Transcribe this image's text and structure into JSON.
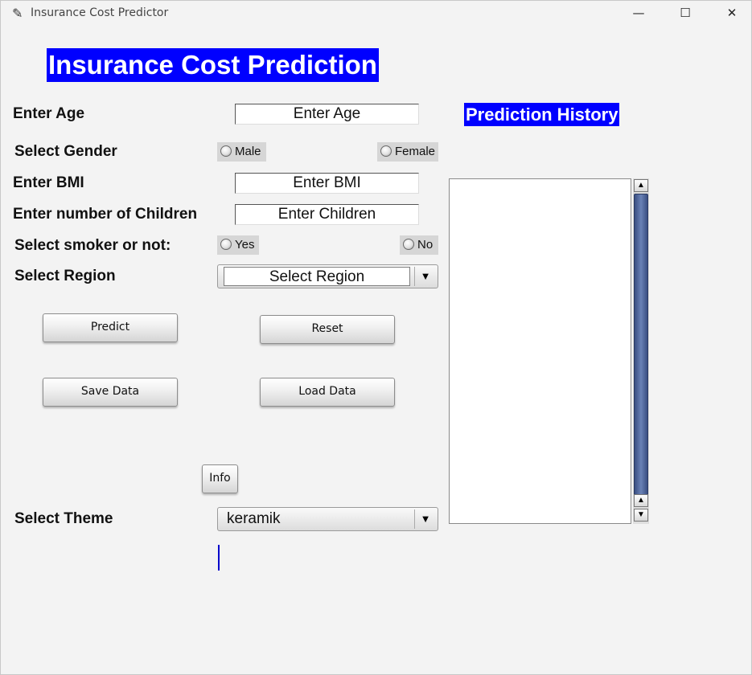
{
  "window": {
    "title": "Insurance Cost Predictor",
    "controls": {
      "minimize": "—",
      "maximize": "☐",
      "close": "✕"
    }
  },
  "heading": "Insurance Cost Prediction",
  "form": {
    "age_label": "Enter Age",
    "age_value": "Enter Age",
    "gender_label": "Select Gender",
    "gender_options": [
      "Male",
      "Female"
    ],
    "bmi_label": "Enter BMI",
    "bmi_value": "Enter BMI",
    "children_label": "Enter number of Children",
    "children_value": "Enter Children",
    "smoker_label": "Select smoker or not:",
    "smoker_options": [
      "Yes",
      "No"
    ],
    "region_label": "Select Region",
    "region_value": "Select Region"
  },
  "buttons": {
    "predict": "Predict",
    "reset": "Reset",
    "save": "Save Data",
    "load": "Load Data",
    "info": "Info"
  },
  "theme": {
    "label": "Select Theme",
    "value": "keramik"
  },
  "history": {
    "title": "Prediction History",
    "items": []
  },
  "icons": {
    "app": "feather-icon",
    "dropdown": "dropdown-arrow-icon",
    "scroll_up": "scroll-up-icon",
    "scroll_down": "scroll-down-icon"
  },
  "colors": {
    "heading_bg": "#0000ff",
    "heading_fg": "#ffffff",
    "scrollbar_thumb": "#4e6398",
    "cursor": "#0000cc"
  }
}
